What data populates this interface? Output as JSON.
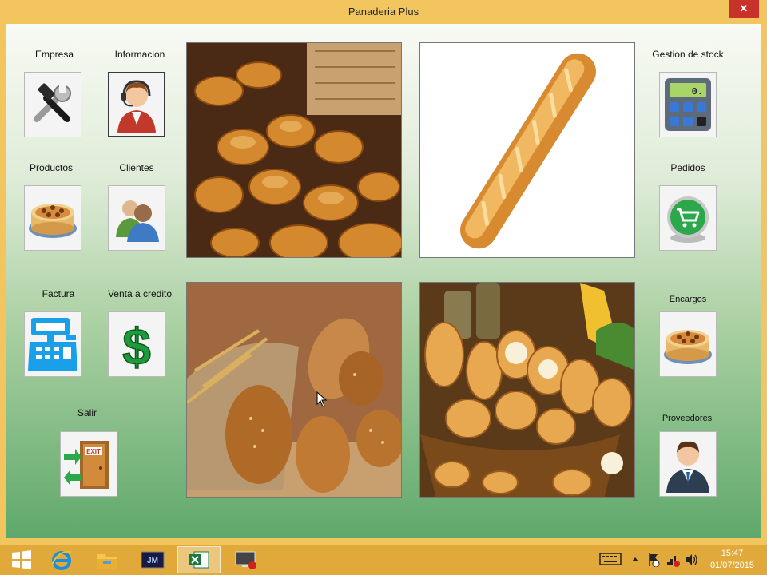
{
  "window": {
    "title": "Panaderia Plus",
    "close_glyph": "✕"
  },
  "modules": {
    "empresa": {
      "label": "Empresa",
      "icon": "tools-icon"
    },
    "informacion": {
      "label": "Informacion",
      "icon": "support-agent-icon"
    },
    "productos": {
      "label": "Productos",
      "icon": "cake-icon"
    },
    "clientes": {
      "label": "Clientes",
      "icon": "users-icon"
    },
    "factura": {
      "label": "Factura",
      "icon": "cash-register-icon"
    },
    "venta_credito": {
      "label": "Venta a credito",
      "icon": "dollar-icon"
    },
    "salir": {
      "label": "Salir",
      "icon": "exit-door-icon"
    },
    "gestion_stock": {
      "label": "Gestion de stock",
      "icon": "calculator-icon"
    },
    "pedidos": {
      "label": "Pedidos",
      "icon": "shopping-cart-icon"
    },
    "encargos": {
      "label": "Encargos",
      "icon": "cake-icon"
    },
    "proveedores": {
      "label": "Proveedores",
      "icon": "businessman-icon"
    }
  },
  "calculator_display": "0.",
  "exit_sign": "EXIT",
  "taskbar": {
    "apps": [
      "windows-start-icon",
      "internet-explorer-icon",
      "file-explorer-icon",
      "media-app-icon",
      "excel-icon",
      "remote-desktop-icon"
    ],
    "time": "15:47",
    "date": "01/07/2015"
  }
}
